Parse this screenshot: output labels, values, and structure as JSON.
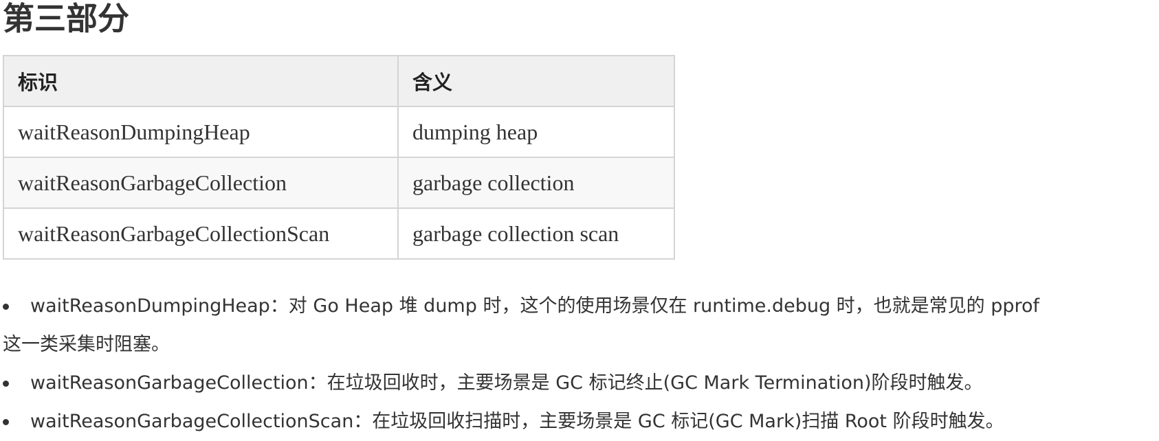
{
  "heading": "第三部分",
  "table": {
    "headers": [
      "标识",
      "含义"
    ],
    "rows": [
      [
        "waitReasonDumpingHeap",
        "dumping heap"
      ],
      [
        "waitReasonGarbageCollection",
        "garbage collection"
      ],
      [
        "waitReasonGarbageCollectionScan",
        "garbage collection scan"
      ]
    ]
  },
  "bullets": [
    {
      "line1": "waitReasonDumpingHeap：对 Go Heap 堆 dump 时，这个的使用场景仅在 runtime.debug 时，也就是常见的 pprof",
      "line2": "这一类采集时阻塞。"
    },
    {
      "line1": "waitReasonGarbageCollection：在垃圾回收时，主要场景是 GC 标记终止(GC Mark Termination)阶段时触发。"
    },
    {
      "line1": "waitReasonGarbageCollectionScan：在垃圾回收扫描时，主要场景是 GC 标记(GC Mark)扫描 Root 阶段时触发。"
    }
  ]
}
